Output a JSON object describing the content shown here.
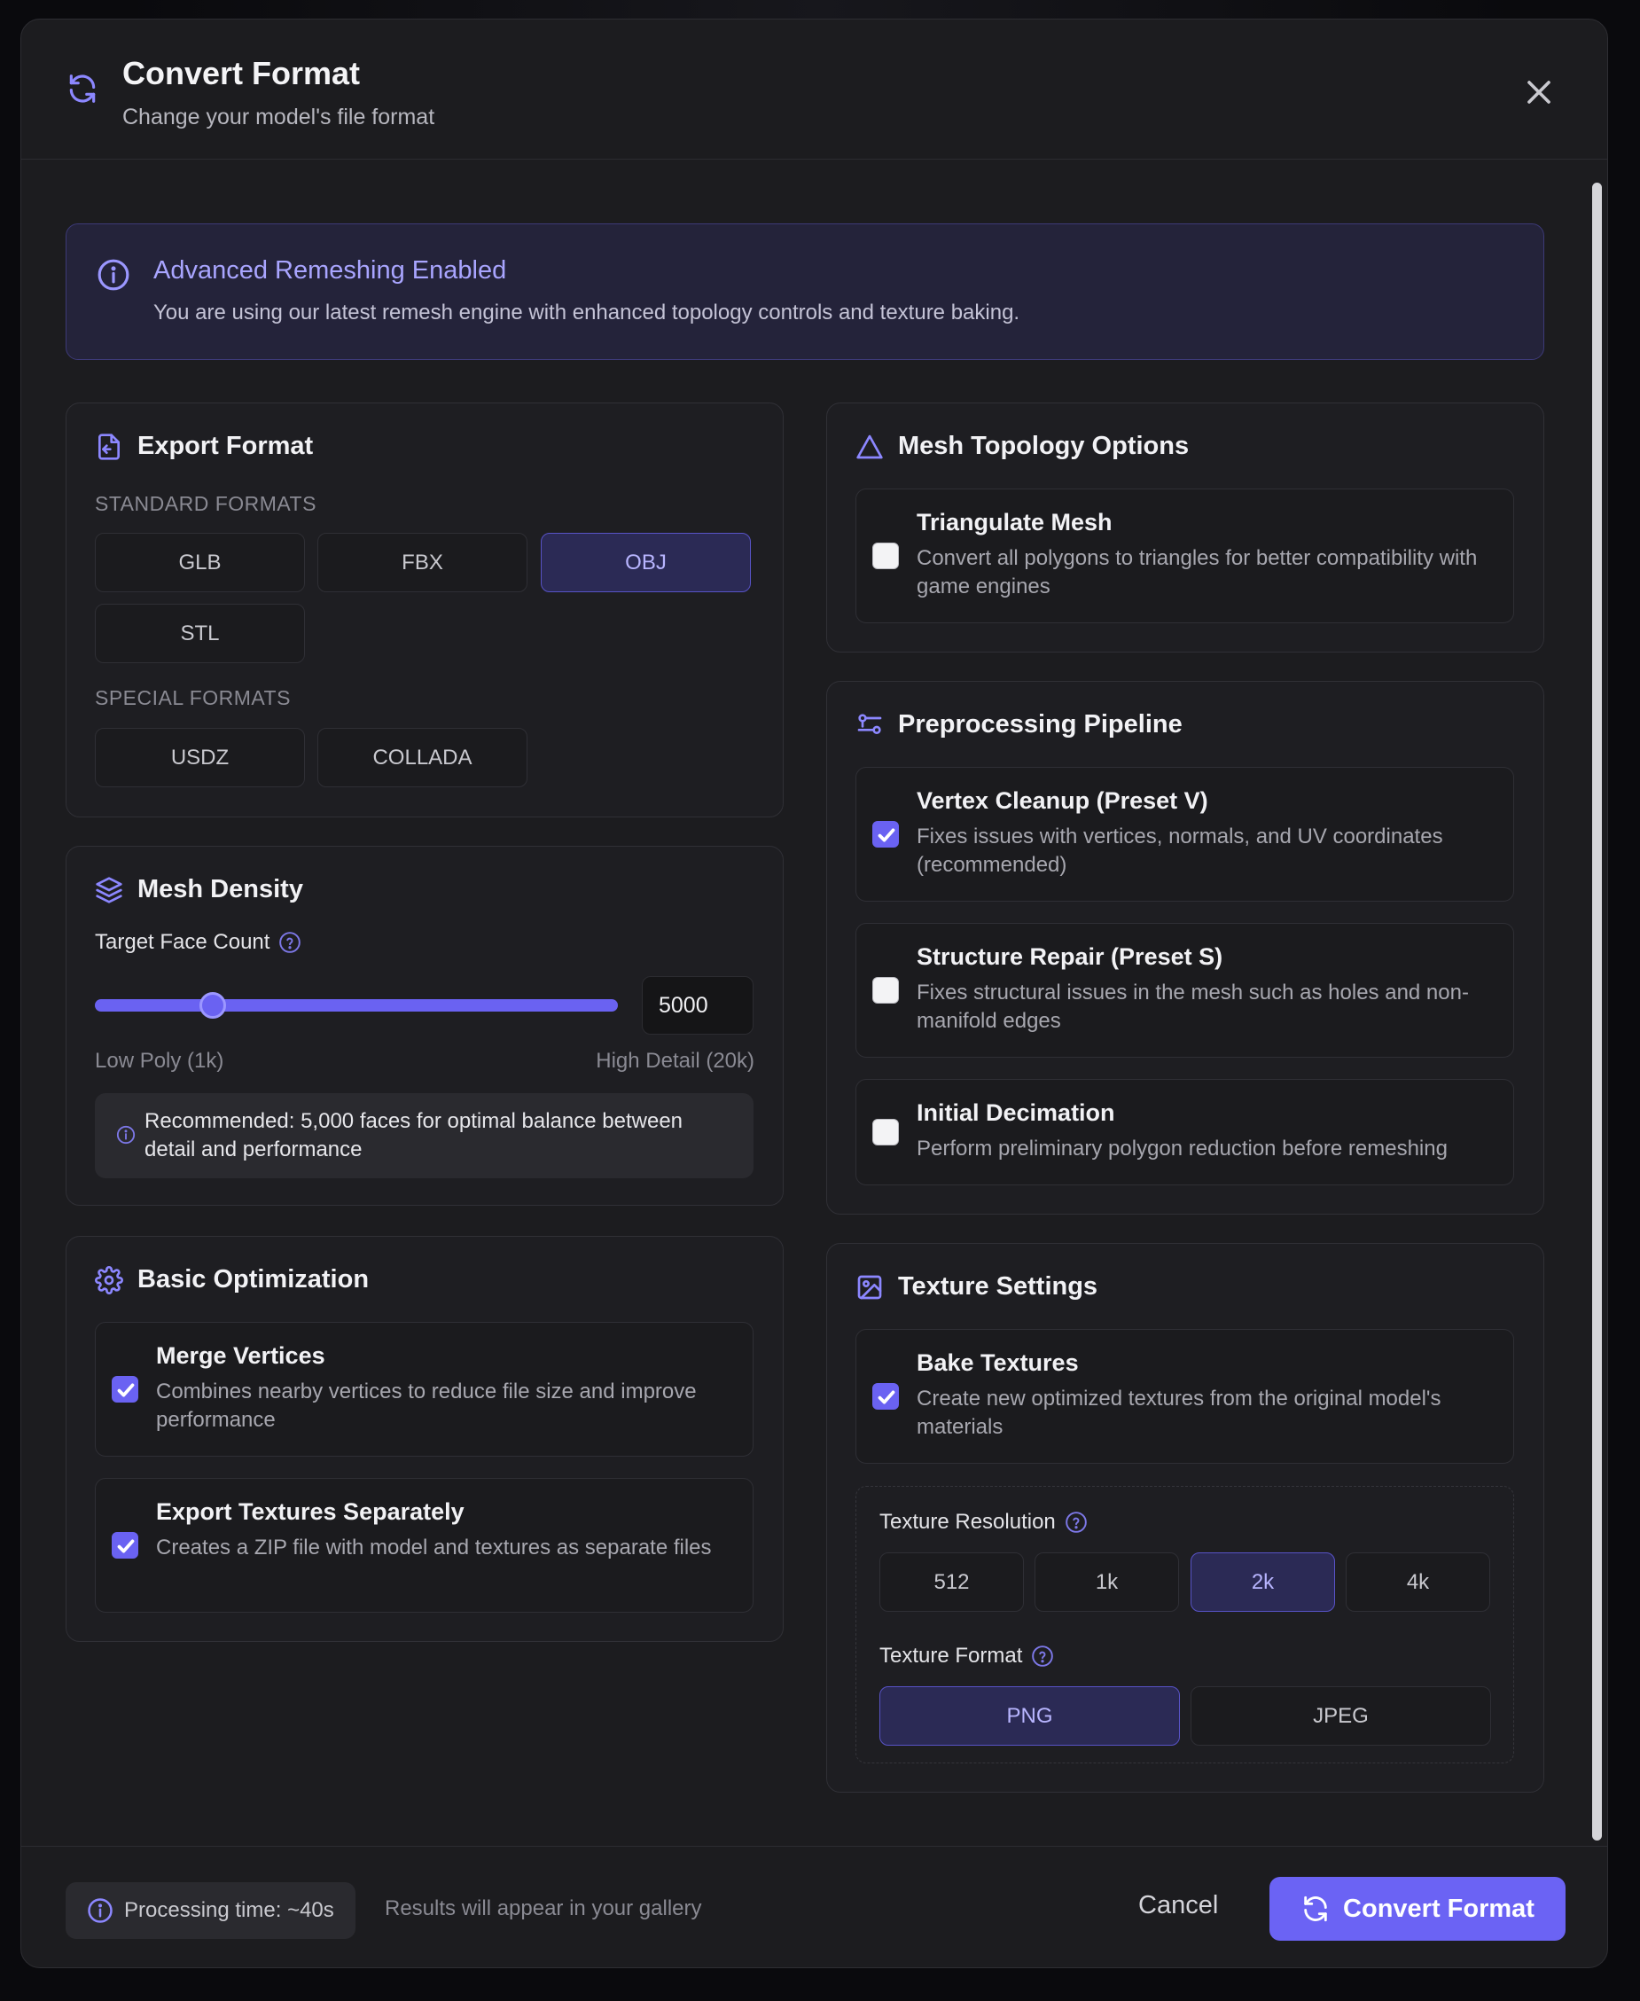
{
  "header": {
    "title": "Convert Format",
    "subtitle": "Change your model's file format",
    "icon": "refresh-icon"
  },
  "banner": {
    "title": "Advanced Remeshing Enabled",
    "text": "You are using our latest remesh engine with enhanced topology controls and texture baking."
  },
  "export_format": {
    "title": "Export Format",
    "standard_label": "STANDARD FORMATS",
    "standard": [
      "GLB",
      "FBX",
      "OBJ",
      "STL"
    ],
    "special_label": "SPECIAL FORMATS",
    "special": [
      "USDZ",
      "COLLADA"
    ],
    "selected": "OBJ"
  },
  "mesh_density": {
    "title": "Mesh Density",
    "label": "Target Face Count",
    "value": "5000",
    "slider_fraction": 0.21,
    "low_label": "Low Poly (1k)",
    "high_label": "High Detail (20k)",
    "recommendation": "Recommended: 5,000 faces for optimal balance between detail and performance"
  },
  "basic_optimization": {
    "title": "Basic Optimization",
    "options": [
      {
        "title": "Merge Vertices",
        "desc": "Combines nearby vertices to reduce file size and improve performance",
        "checked": true
      },
      {
        "title": "Export Textures Separately",
        "desc": "Creates a ZIP file with model and textures as separate files",
        "checked": true
      }
    ]
  },
  "mesh_topology": {
    "title": "Mesh Topology Options",
    "options": [
      {
        "title": "Triangulate Mesh",
        "desc": "Convert all polygons to triangles for better compatibility with game engines",
        "checked": false
      }
    ]
  },
  "preprocessing": {
    "title": "Preprocessing Pipeline",
    "options": [
      {
        "title": "Vertex Cleanup (Preset V)",
        "desc": "Fixes issues with vertices, normals, and UV coordinates (recommended)",
        "checked": true
      },
      {
        "title": "Structure Repair (Preset S)",
        "desc": "Fixes structural issues in the mesh such as holes and non-manifold edges",
        "checked": false
      },
      {
        "title": "Initial Decimation",
        "desc": "Perform preliminary polygon reduction before remeshing",
        "checked": false
      }
    ]
  },
  "texture_settings": {
    "title": "Texture Settings",
    "bake": {
      "title": "Bake Textures",
      "desc": "Create new optimized textures from the original model's materials",
      "checked": true
    },
    "resolution_label": "Texture Resolution",
    "resolutions": [
      "512",
      "1k",
      "2k",
      "4k"
    ],
    "resolution_selected": "2k",
    "format_label": "Texture Format",
    "formats": [
      "PNG",
      "JPEG"
    ],
    "format_selected": "PNG"
  },
  "footer": {
    "processing_time": "Processing time: ~40s",
    "results_note": "Results will appear in your gallery",
    "cancel_label": "Cancel",
    "convert_label": "Convert Format"
  },
  "colors": {
    "accent": "#6b63f4",
    "accent_text": "#a9a5ff",
    "background": "#1c1c1f"
  }
}
